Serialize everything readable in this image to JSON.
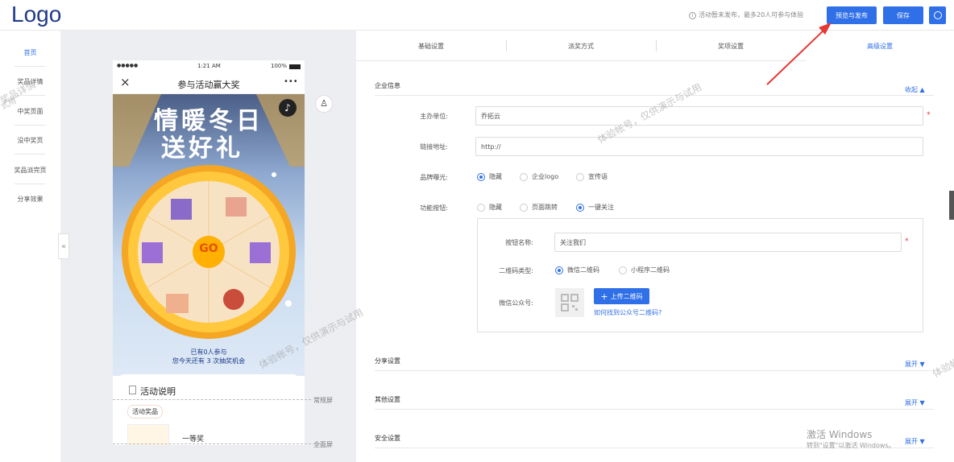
{
  "header": {
    "logo": "Logo",
    "notice": "活动暂未发布，最多20人可参与体验",
    "preview_publish_label": "预览与发布",
    "save_label": "保存"
  },
  "sidebar": {
    "items": [
      {
        "label": "首页",
        "active": true
      },
      {
        "label": "奖品详情"
      },
      {
        "label": "中奖页面"
      },
      {
        "label": "没中奖页"
      },
      {
        "label": "奖品派完页"
      },
      {
        "label": "分享效果"
      }
    ],
    "collapse_glyph": "«"
  },
  "phone": {
    "signal": "●●●●●",
    "time": "1:21 AM",
    "battery": "100%",
    "title": "参与活动赢大奖",
    "more": "•••",
    "banner_line1": "情暖冬日",
    "banner_line2": "送好礼",
    "wheel_center": "GO",
    "participants": "已有0人参与",
    "chances": "您今天还有 3 次抽奖机会",
    "card_title": "活动说明",
    "prize_tag": "活动奖品",
    "prize_name": "一等奖"
  },
  "preview_labels": {
    "normal": "常规屏",
    "full": "全面屏"
  },
  "tabs": [
    {
      "label": "基础设置"
    },
    {
      "label": "派奖方式"
    },
    {
      "label": "奖项设置"
    },
    {
      "label": "高级设置",
      "active": true
    }
  ],
  "sections": {
    "company": {
      "title": "企业信息",
      "toggle": "收起",
      "host_label": "主办单位:",
      "host_value": "乔拓云",
      "link_label": "链接地址:",
      "link_value": "http://",
      "brand_label": "品牌曝光:",
      "brand_options": [
        "隐藏",
        "企业logo",
        "宣传语"
      ],
      "brand_selected": 0,
      "func_label": "功能按钮:",
      "func_options": [
        "隐藏",
        "页面跳转",
        "一键关注"
      ],
      "func_selected": 2,
      "btn_name_label": "按钮名称:",
      "btn_name_value": "关注我们",
      "qr_type_label": "二维码类型:",
      "qr_options": [
        "微信二维码",
        "小程序二维码"
      ],
      "qr_selected": 0,
      "wechat_label": "微信公众号:",
      "upload_label": "上传二维码",
      "help_link": "如何找到公众号二维码?"
    },
    "share": {
      "title": "分享设置",
      "toggle": "展开"
    },
    "other": {
      "title": "其他设置",
      "toggle": "展开"
    },
    "security": {
      "title": "安全设置",
      "toggle": "展开"
    }
  },
  "watermarks": {
    "w1": "奖品详情",
    "w2": "体验帐号，仅供演示与试用",
    "w3": "体验帐号，仅供演示与试用",
    "w4": "体验帐",
    "w5": "式用"
  },
  "windows_activation": {
    "line1": "激活 Windows",
    "line2": "转到\"设置\"以激活 Windows。"
  },
  "colors": {
    "accent": "#2f6fe8",
    "arrow": "#e53935"
  }
}
